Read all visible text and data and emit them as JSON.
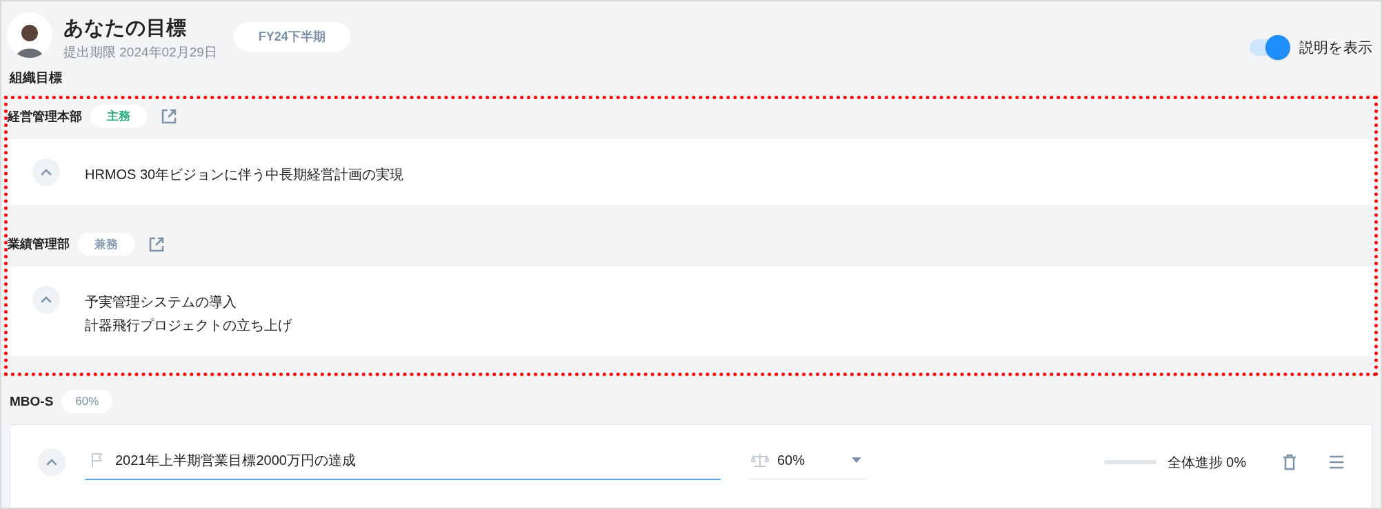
{
  "header": {
    "title": "あなたの目標",
    "deadline": "提出期限 2024年02月29日",
    "period": "FY24下半期",
    "toggle": {
      "label": "説明を表示",
      "on": true
    }
  },
  "org_goals": {
    "title": "組織目標",
    "departments": [
      {
        "name": "経営管理本部",
        "role": {
          "label": "主務",
          "kind": "primary"
        },
        "expanded": true,
        "goals": [
          "HRMOS 30年ビジョンに伴う中長期経営計画の実現"
        ]
      },
      {
        "name": "業績管理部",
        "role": {
          "label": "兼務",
          "kind": "secondary"
        },
        "expanded": true,
        "goals": [
          "予実管理システムの導入",
          "計器飛行プロジェクトの立ち上げ"
        ]
      }
    ]
  },
  "mbo": {
    "title": "MBO-S",
    "weight": "60%",
    "objectives": [
      {
        "title": "2021年上半期営業目標2000万円の達成",
        "expanded": true,
        "weight": "60%",
        "progress": {
          "level": 0,
          "reading": "全体進捗 0%"
        }
      }
    ]
  }
}
